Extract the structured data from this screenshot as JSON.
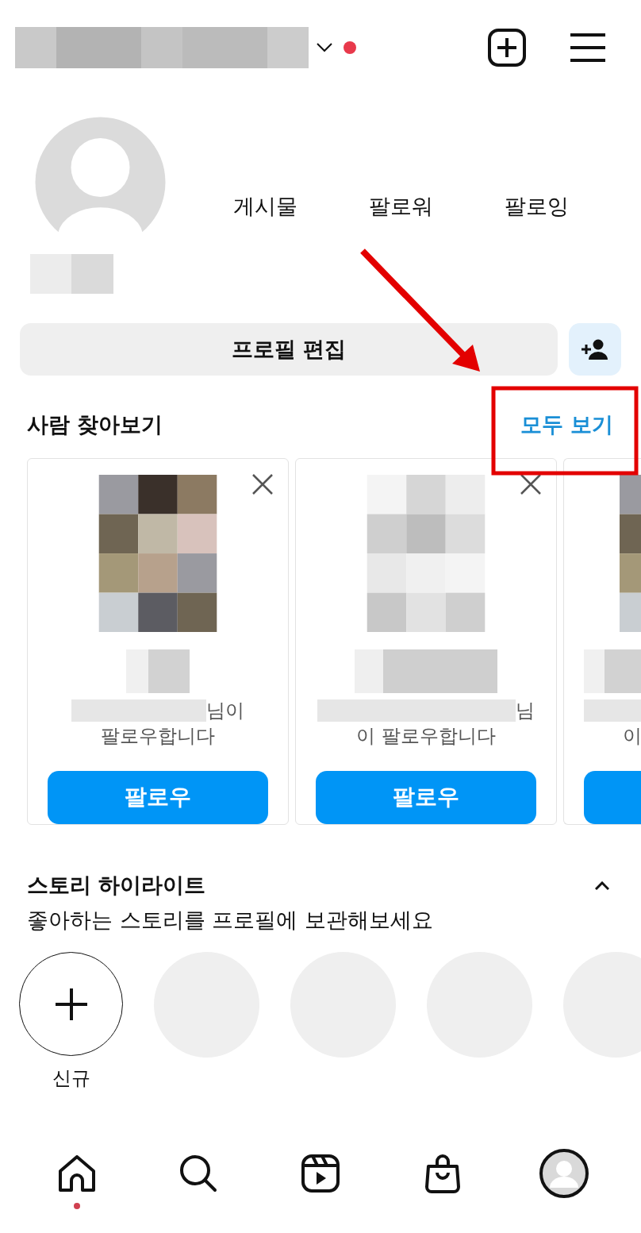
{
  "header": {
    "notification": true
  },
  "stats": [
    {
      "label": "게시물"
    },
    {
      "label": "팔로워"
    },
    {
      "label": "팔로잉"
    }
  ],
  "edit_profile_button": "프로필 편집",
  "discover": {
    "title": "사람 찾아보기",
    "see_all": "모두 보기",
    "cards": [
      {
        "kind": "full",
        "line1": "님이",
        "line2": "팔로우합니다",
        "button": "팔로우",
        "dismissable": true
      },
      {
        "kind": "full",
        "line1": "님",
        "line2": "이 팔로우합니다",
        "button": "팔로우",
        "dismissable": true
      },
      {
        "kind": "clipped",
        "line2": "이",
        "dismissable": false
      }
    ]
  },
  "highlights": {
    "title": "스토리 하이라이트",
    "subtitle": "좋아하는 스토리를 프로필에 보관해보세요",
    "expanded": true,
    "new_label": "신규"
  },
  "nav": [
    {
      "selected": false,
      "badge": true
    },
    {
      "selected": false,
      "badge": false
    },
    {
      "selected": false,
      "badge": false
    },
    {
      "selected": false,
      "badge": false
    },
    {
      "selected": true,
      "badge": false
    }
  ]
}
